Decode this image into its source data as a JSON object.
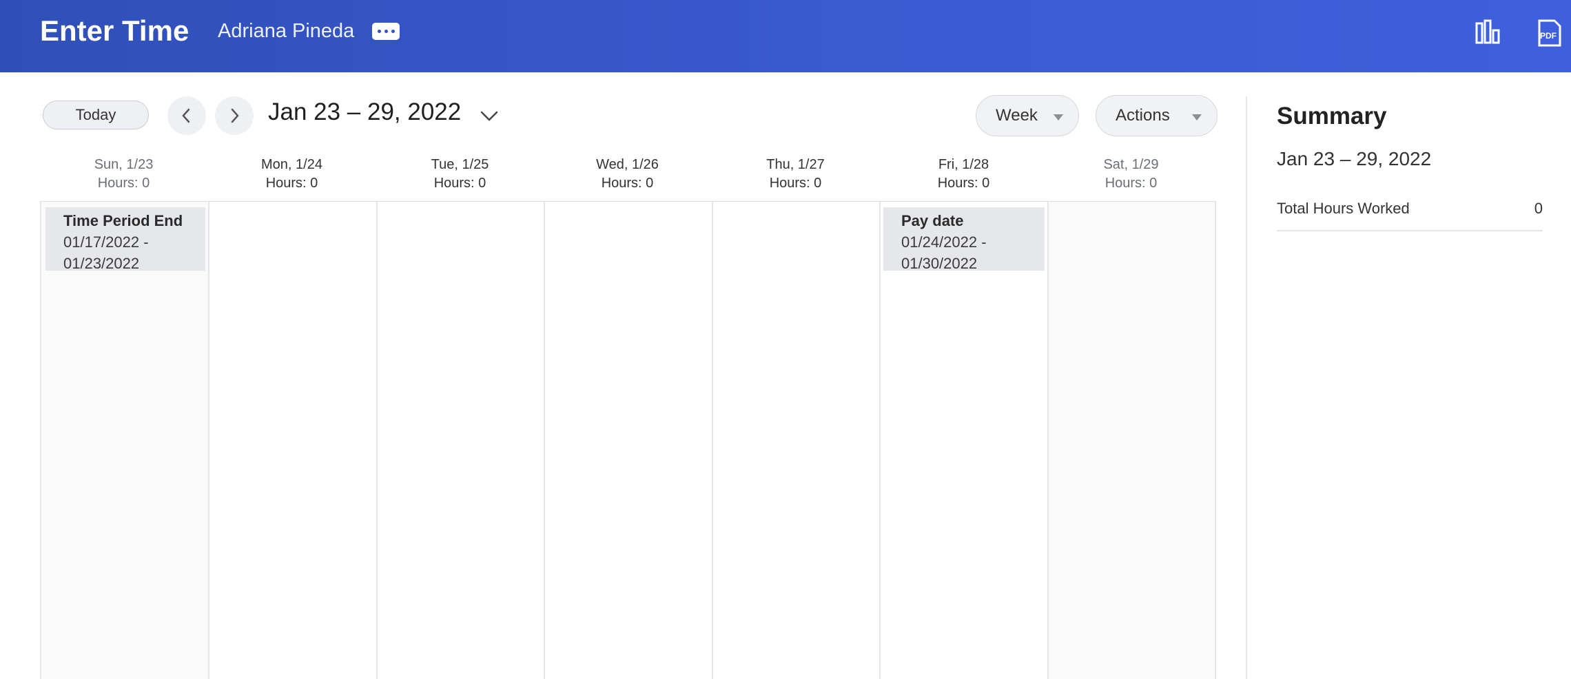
{
  "header": {
    "title": "Enter Time",
    "user": "Adriana Pineda",
    "more_icon": "more-dots-icon",
    "icons": [
      "bar-chart-icon",
      "pdf-icon"
    ],
    "pdf_label": "PDF"
  },
  "toolbar": {
    "today_label": "Today",
    "prev_icon": "chevron-left-icon",
    "next_icon": "chevron-right-icon",
    "range": "Jan 23 – 29, 2022",
    "range_dropdown_icon": "chevron-down-icon",
    "view_label": "Week",
    "actions_label": "Actions"
  },
  "calendar": {
    "days": [
      {
        "label": "Sun, 1/23",
        "hours": "Hours: 0"
      },
      {
        "label": "Mon, 1/24",
        "hours": "Hours: 0"
      },
      {
        "label": "Tue, 1/25",
        "hours": "Hours: 0"
      },
      {
        "label": "Wed, 1/26",
        "hours": "Hours: 0"
      },
      {
        "label": "Thu, 1/27",
        "hours": "Hours: 0"
      },
      {
        "label": "Fri, 1/28",
        "hours": "Hours: 0"
      },
      {
        "label": "Sat, 1/29",
        "hours": "Hours: 0"
      }
    ],
    "events": [
      {
        "title": "Time Period End",
        "line1": "01/17/2022 -",
        "line2": "01/23/2022"
      },
      {
        "title": "Pay date",
        "line1": "01/24/2022 -",
        "line2": "01/30/2022"
      }
    ]
  },
  "summary": {
    "title": "Summary",
    "range": "Jan 23 – 29, 2022",
    "total_label": "Total Hours Worked",
    "total_value": "0"
  },
  "colors": {
    "header_start": "#2f4fb8",
    "header_end": "#3f60dc",
    "event_bg": "#e6e7ea"
  }
}
